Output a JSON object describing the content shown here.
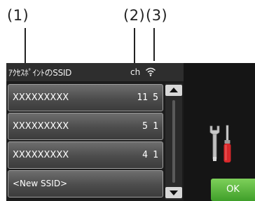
{
  "callouts": {
    "one": "(1)",
    "two": "(2)",
    "three": "(3)"
  },
  "header": {
    "title": "ｱｸｾｽﾎﾟｲﾝﾄのSSID",
    "ch_label": "ch",
    "signal_icon": "wifi-signal-icon"
  },
  "networks": [
    {
      "ssid": "XXXXXXXXX",
      "ch": "11",
      "signal": "5"
    },
    {
      "ssid": "XXXXXXXXX",
      "ch": "5",
      "signal": "1"
    },
    {
      "ssid": "XXXXXXXXX",
      "ch": "4",
      "signal": "1"
    }
  ],
  "new_ssid_label": "<New SSID>",
  "scrollbar": {
    "up_icon": "scroll-up-icon",
    "down_icon": "scroll-down-icon"
  },
  "settings_icon": "wrench-screwdriver-icon",
  "ok_label": "OK",
  "colors": {
    "ok_button": "#4fb236",
    "screen_bg": "#1c1c1c",
    "screwdriver_handle": "#d8282b"
  }
}
